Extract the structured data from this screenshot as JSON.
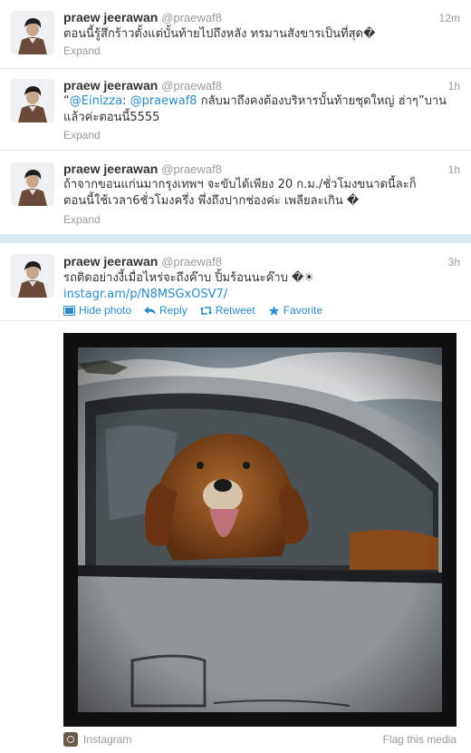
{
  "colors": {
    "link": "#2a8bc8",
    "divider_band": "#dbe9f2",
    "muted": "#999999"
  },
  "tweets": [
    {
      "name": "praew jeerawan",
      "handle": "@praewaf8",
      "time": "12m",
      "text": "ตอนนี้รู้สึกร้าวตั้งแต่บั้นท้ายไปถึงหลัง ทรมานสังขารเป็นที่สุด�",
      "expand": "Expand"
    },
    {
      "name": "praew jeerawan",
      "handle": "@praewaf8",
      "time": "1h",
      "text_open_quote": "“",
      "mention1": "@Einizza",
      "mention_sep": ": ",
      "mention2": "@praewaf8",
      "text_line1_rest": " กลับมาถึงคงต้องบริหารบั้นท้ายชุดใหญ่ ฮ่าๆ”บาน",
      "text_line2": "แล้วค่ะตอนนี้5555",
      "expand": "Expand"
    },
    {
      "name": "praew jeerawan",
      "handle": "@praewaf8",
      "time": "1h",
      "text_line1": "ถ้าจากขอนแก่นมากรุงเทพฯ จะขับได้เพียง 20 ก.ม./ชั่วโมงขนาดนี้ละก็",
      "text_line2": "ตอนนี้ใช้เวลา6ชั่วโมงครึ่ง พึ่งถึงปากช่องค่ะ เพลียละเกิน �",
      "expand": "Expand"
    },
    {
      "name": "praew jeerawan",
      "handle": "@praewaf8",
      "time": "3h",
      "text": "รถติดอย่างงี้เมื่อไหร่จะถึงค๊าบ ปิ้มร้อนนะค๊าบ �☀",
      "link": "instagr.am/p/N8MSGxOSV7/",
      "actions": {
        "hide_photo": "Hide photo",
        "reply": "Reply",
        "retweet": "Retweet",
        "favorite": "Favorite"
      },
      "media": {
        "source": "Instagram",
        "flag": "Flag this media"
      }
    }
  ]
}
